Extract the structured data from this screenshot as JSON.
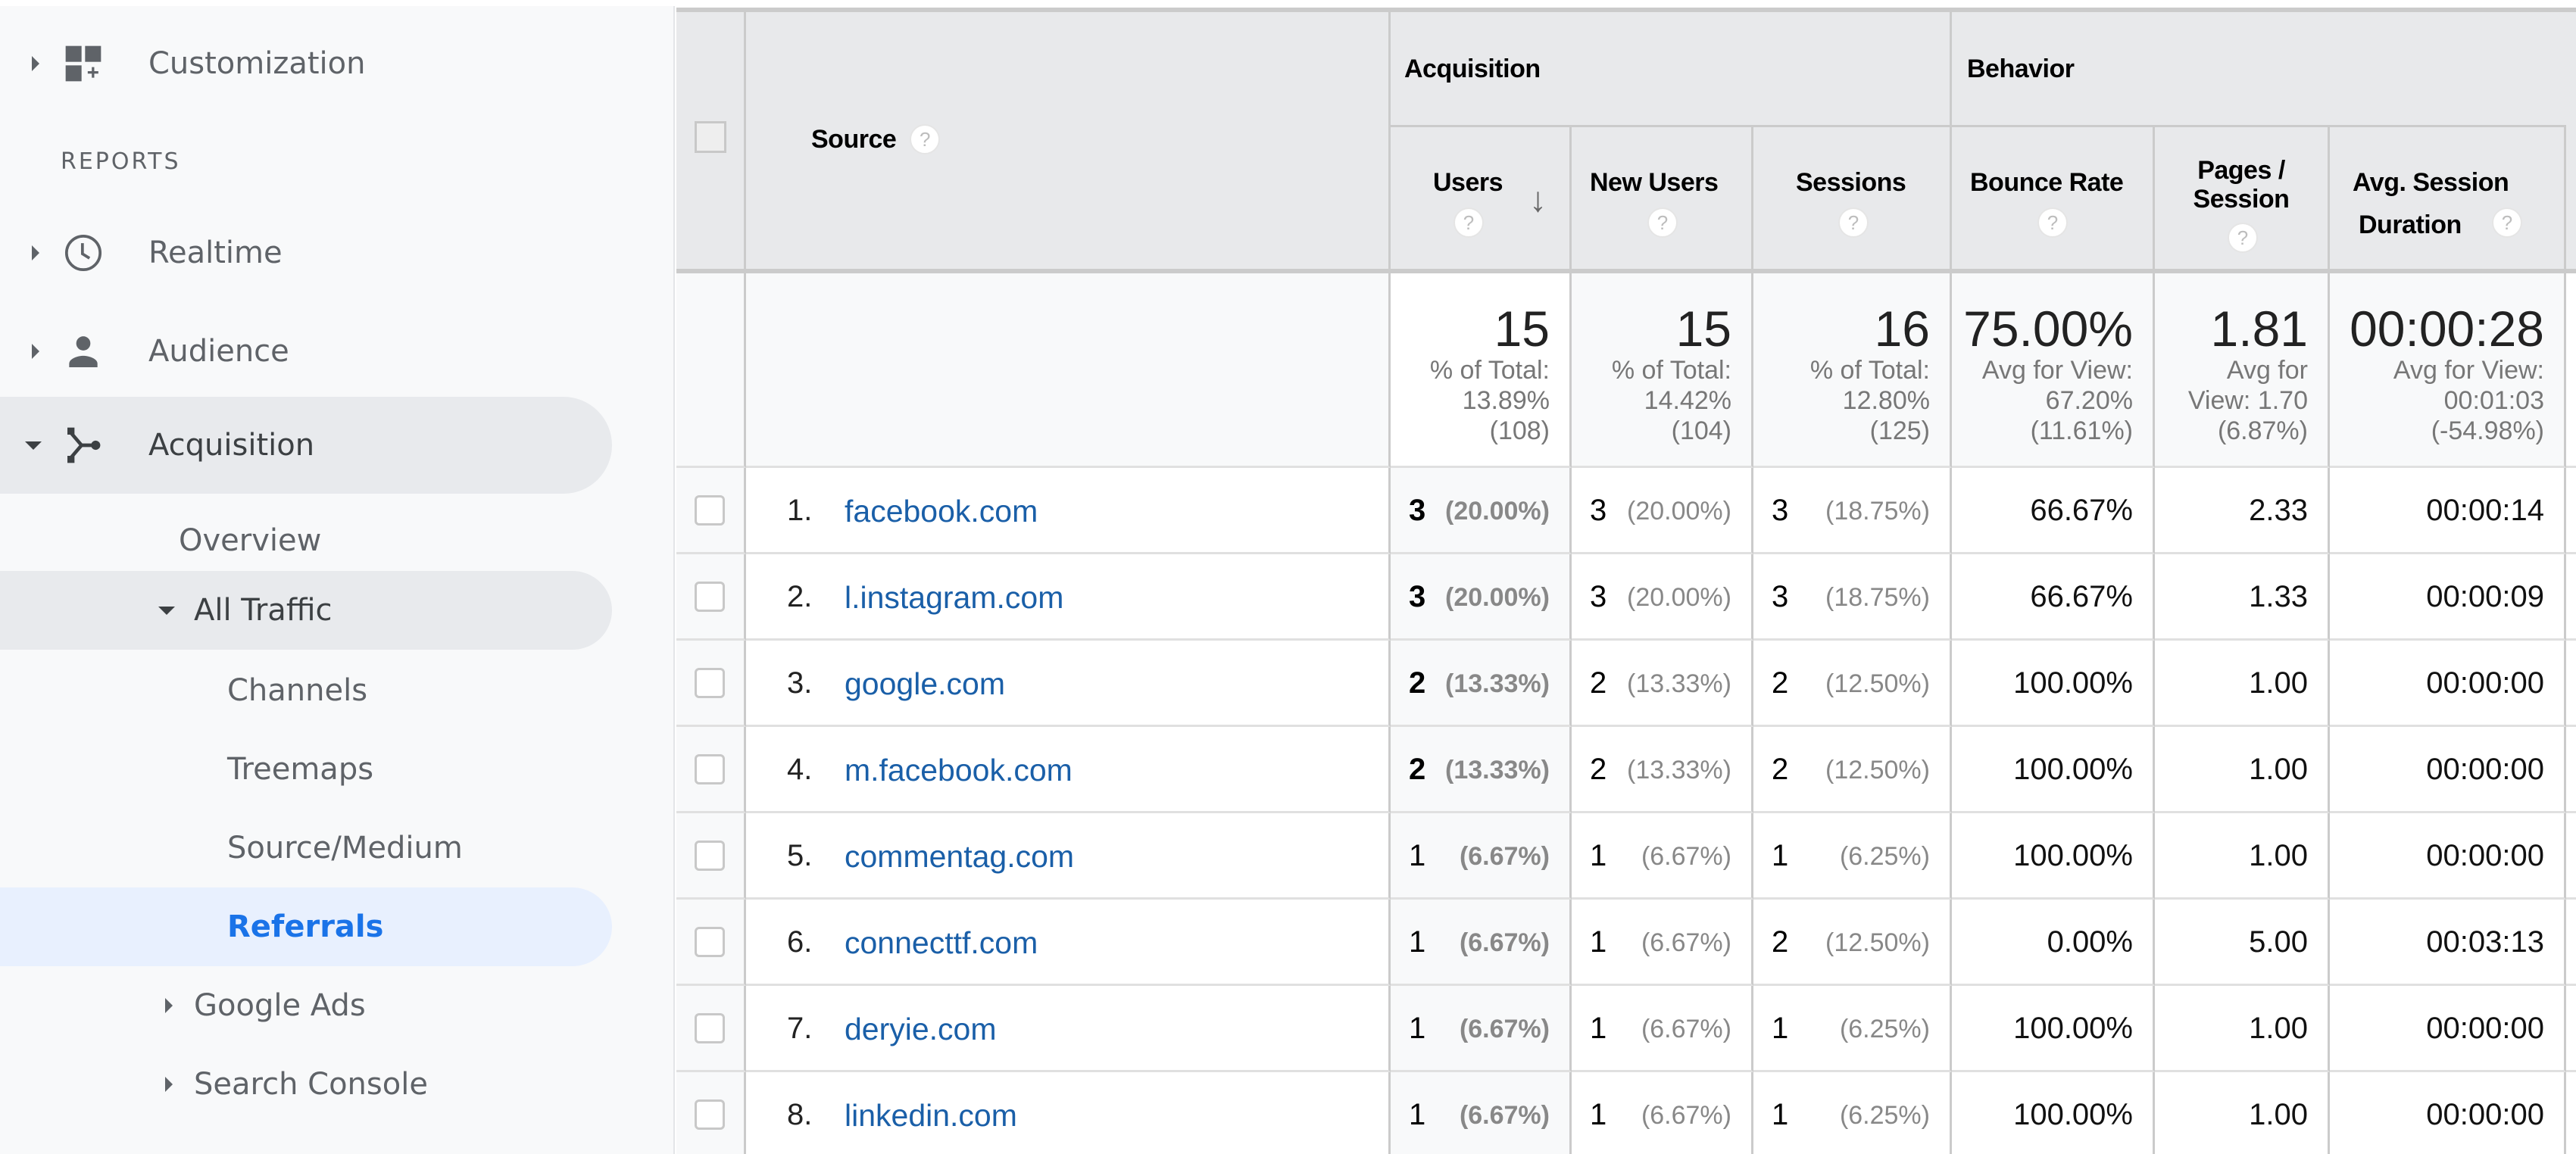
{
  "sidebar": {
    "customization": {
      "label": "Customization",
      "icon": "dashboard-add-icon"
    },
    "section_label": "REPORTS",
    "items": [
      {
        "label": "Realtime",
        "icon": "clock-icon"
      },
      {
        "label": "Audience",
        "icon": "person-icon"
      },
      {
        "label": "Acquisition",
        "icon": "acquisition-fork-icon"
      }
    ],
    "acquisition_children": {
      "overview": "Overview",
      "all_traffic": "All Traffic",
      "all_traffic_children": [
        "Channels",
        "Treemaps",
        "Source/Medium",
        "Referrals"
      ],
      "google_ads": "Google Ads",
      "search_console": "Search Console"
    },
    "selected": "Referrals"
  },
  "table": {
    "dimension_header": "Source",
    "groups": {
      "acquisition": "Acquisition",
      "behavior": "Behavior"
    },
    "columns": {
      "users": "Users",
      "new_users": "New Users",
      "sessions": "Sessions",
      "bounce_rate": "Bounce Rate",
      "pages_session_1": "Pages /",
      "pages_session_2": "Session",
      "avg_duration_1": "Avg. Session",
      "avg_duration_2": "Duration"
    },
    "help_glyph": "?",
    "sort_glyph": "↓",
    "totals": {
      "users": {
        "value": "15",
        "l1": "% of Total:",
        "l2": "13.89%",
        "l3": "(108)"
      },
      "new_users": {
        "value": "15",
        "l1": "% of Total:",
        "l2": "14.42%",
        "l3": "(104)"
      },
      "sessions": {
        "value": "16",
        "l1": "% of Total:",
        "l2": "12.80%",
        "l3": "(125)"
      },
      "bounce_rate": {
        "value": "75.00%",
        "l1": "Avg for View:",
        "l2": "67.20%",
        "l3": "(11.61%)"
      },
      "pages_session": {
        "value": "1.81",
        "l1": "Avg for",
        "l2": "View: 1.70",
        "l3": "(6.87%)"
      },
      "avg_duration": {
        "value": "00:00:28",
        "l1": "Avg for View:",
        "l2": "00:01:03",
        "l3": "(-54.98%)"
      }
    },
    "rows": [
      {
        "idx": "1.",
        "source": "facebook.com",
        "users": "3",
        "users_pct": "(20.00%)",
        "new_users": "3",
        "new_users_pct": "(20.00%)",
        "sessions": "3",
        "sessions_pct": "(18.75%)",
        "bounce_rate": "66.67%",
        "pages_session": "2.33",
        "avg_duration": "00:00:14"
      },
      {
        "idx": "2.",
        "source": "l.instagram.com",
        "users": "3",
        "users_pct": "(20.00%)",
        "new_users": "3",
        "new_users_pct": "(20.00%)",
        "sessions": "3",
        "sessions_pct": "(18.75%)",
        "bounce_rate": "66.67%",
        "pages_session": "1.33",
        "avg_duration": "00:00:09"
      },
      {
        "idx": "3.",
        "source": "google.com",
        "users": "2",
        "users_pct": "(13.33%)",
        "new_users": "2",
        "new_users_pct": "(13.33%)",
        "sessions": "2",
        "sessions_pct": "(12.50%)",
        "bounce_rate": "100.00%",
        "pages_session": "1.00",
        "avg_duration": "00:00:00"
      },
      {
        "idx": "4.",
        "source": "m.facebook.com",
        "users": "2",
        "users_pct": "(13.33%)",
        "new_users": "2",
        "new_users_pct": "(13.33%)",
        "sessions": "2",
        "sessions_pct": "(12.50%)",
        "bounce_rate": "100.00%",
        "pages_session": "1.00",
        "avg_duration": "00:00:00"
      },
      {
        "idx": "5.",
        "source": "commentag.com",
        "users": "1",
        "users_pct": "(6.67%)",
        "new_users": "1",
        "new_users_pct": "(6.67%)",
        "sessions": "1",
        "sessions_pct": "(6.25%)",
        "bounce_rate": "100.00%",
        "pages_session": "1.00",
        "avg_duration": "00:00:00"
      },
      {
        "idx": "6.",
        "source": "connecttf.com",
        "users": "1",
        "users_pct": "(6.67%)",
        "new_users": "1",
        "new_users_pct": "(6.67%)",
        "sessions": "2",
        "sessions_pct": "(12.50%)",
        "bounce_rate": "0.00%",
        "pages_session": "5.00",
        "avg_duration": "00:03:13"
      },
      {
        "idx": "7.",
        "source": "deryie.com",
        "users": "1",
        "users_pct": "(6.67%)",
        "new_users": "1",
        "new_users_pct": "(6.67%)",
        "sessions": "1",
        "sessions_pct": "(6.25%)",
        "bounce_rate": "100.00%",
        "pages_session": "1.00",
        "avg_duration": "00:00:00"
      },
      {
        "idx": "8.",
        "source": "linkedin.com",
        "users": "1",
        "users_pct": "(6.67%)",
        "new_users": "1",
        "new_users_pct": "(6.67%)",
        "sessions": "1",
        "sessions_pct": "(6.25%)",
        "bounce_rate": "100.00%",
        "pages_session": "1.00",
        "avg_duration": "00:00:00"
      }
    ]
  },
  "colors": {
    "link": "#1a5fa8",
    "selected_nav_bg": "#e8f0fe",
    "selected_nav_text": "#1a73e8",
    "header_bg": "#e8e9eb"
  }
}
